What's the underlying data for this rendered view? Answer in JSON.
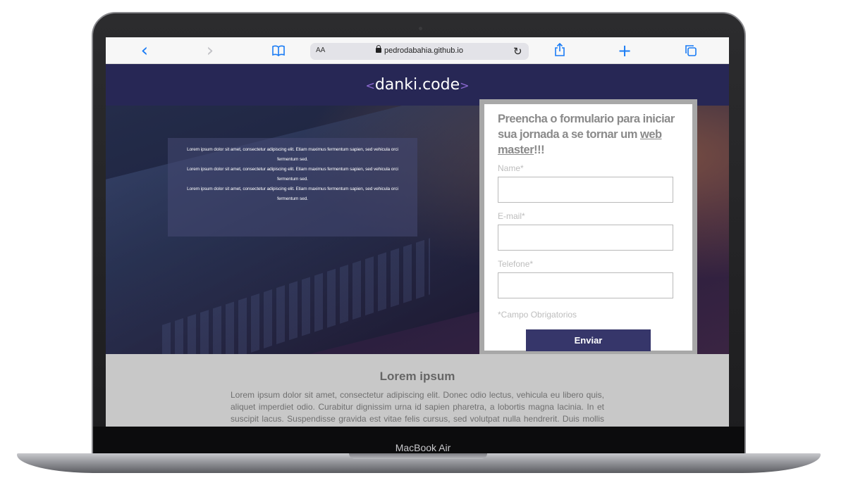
{
  "device": {
    "model_label": "MacBook Air"
  },
  "browser": {
    "back_icon": "‹",
    "forward_icon": "›",
    "aa_label": "AA",
    "url": "pedrodabahia.github.io",
    "reload_icon": "↻",
    "plus_icon": "+"
  },
  "site": {
    "logo_left": "<",
    "logo_text": "danki.code",
    "logo_right": ">",
    "accent_color": "#272755",
    "button_color": "#36366a"
  },
  "hero": {
    "paragraphs": [
      "Lorem ipsum dolor sit amet, consectetur adipiscing elit. Etiam maximus fermentum sapien, sed vehicula orci fermentum sed.",
      "Lorem ipsum dolor sit amet, consectetur adipiscing elit. Etiam maximus fermentum sapien, sed vehicula orci fermentum sed.",
      "Lorem ipsum dolor sit amet, consectetur adipiscing elit. Etiam maximus fermentum sapien, sed vehicula orci fermentum sed."
    ]
  },
  "form": {
    "title_prefix": "Preencha o formulario para iniciar sua jornada a se tornar um ",
    "title_link": "web master",
    "title_suffix": "!!!",
    "name_label": "Name*",
    "email_label": "E-mail*",
    "phone_label": "Telefone*",
    "required_note": "*Campo Obrigatorios",
    "submit_label": "Enviar"
  },
  "section": {
    "heading": "Lorem ipsum",
    "body": "Lorem ipsum dolor sit amet, consectetur adipiscing elit. Donec odio lectus, vehicula eu libero quis, aliquet imperdiet odio. Curabitur dignissim urna id sapien pharetra, a lobortis magna lacinia. In et suscipit lacus. Suspendisse gravida est vitae felis cursus, sed volutpat nulla hendrerit. Duis mollis bibendum ullamcorper."
  }
}
